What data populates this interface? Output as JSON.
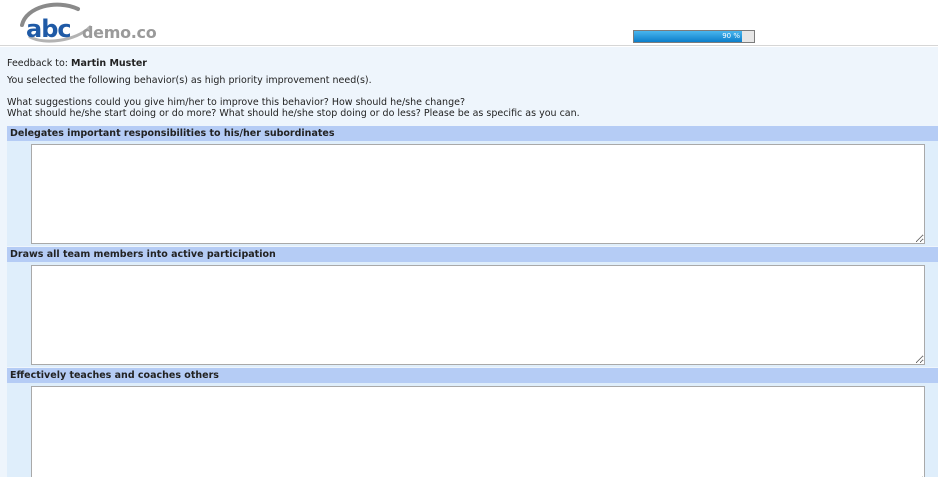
{
  "header": {
    "logo_text_primary": "abc",
    "logo_text_secondary": "demo.co",
    "progress": {
      "percent": 90,
      "label": "90 %"
    }
  },
  "intro": {
    "feedback_prefix": "Feedback to:",
    "feedback_name": "Martin Muster",
    "selected_text": "You selected the following behavior(s) as high priority improvement need(s).",
    "question_line1": "What suggestions could you give him/her to improve this behavior? How should he/she change?",
    "question_line2": "What should he/she start doing or do more? What should he/she stop doing or do less? Please be as specific as you can."
  },
  "sections": [
    {
      "title": "Delegates important responsibilities to his/her subordinates",
      "value": ""
    },
    {
      "title": "Draws all team members into active participation",
      "value": ""
    },
    {
      "title": "Effectively teaches and coaches others",
      "value": ""
    }
  ],
  "colors": {
    "section_header": "#b5ccf5",
    "section_body": "#dfeefb",
    "page_background": "#eef5fc",
    "progress_fill": "#0c7fca",
    "logo_primary": "#1f5aa6"
  }
}
